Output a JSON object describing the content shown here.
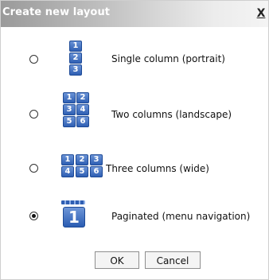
{
  "window": {
    "title": "Create new layout",
    "close_glyph": "X"
  },
  "options": [
    {
      "label": "Single column (portrait)",
      "icon": "single-column-layout-icon",
      "tiles": [
        "1",
        "2",
        "3"
      ],
      "selected": false
    },
    {
      "label": "Two columns (landscape)",
      "icon": "two-columns-layout-icon",
      "tiles": [
        "1",
        "2",
        "3",
        "4",
        "5",
        "6"
      ],
      "selected": false
    },
    {
      "label": "Three columns (wide)",
      "icon": "three-columns-layout-icon",
      "tiles": [
        "1",
        "2",
        "3",
        "4",
        "5",
        "6"
      ],
      "selected": false
    },
    {
      "label": "Paginated (menu navigation)",
      "icon": "paginated-layout-icon",
      "tiles": [
        "1"
      ],
      "selected": true
    }
  ],
  "buttons": {
    "ok_label": "OK",
    "cancel_label": "Cancel"
  },
  "colors": {
    "accent_blue": "#2f5fb3",
    "title_text": "#ffffff"
  }
}
